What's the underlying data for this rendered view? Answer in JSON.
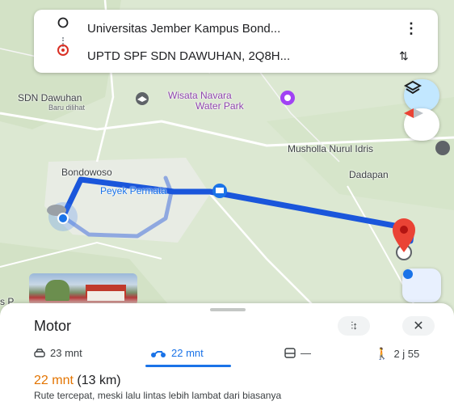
{
  "search": {
    "origin": "Universitas Jember Kampus Bond...",
    "destination": "UPTD SPF SDN DAWUHAN, 2Q8H...",
    "more_icon": "more-vert-icon",
    "swap_icon": "swap-icon"
  },
  "map": {
    "labels": {
      "sdn_dawuhan": "SDN Dawuhan",
      "baru_dilihat": "Baru dilihat",
      "wisata_line1": "Wisata Navara",
      "wisata_line2": "Water Park",
      "musholla": "Musholla Nurul Idris",
      "bondowoso": "Bondowoso",
      "dadapan": "Dadapan",
      "peyek": "Peyek Permata",
      "s_p": "s P"
    },
    "colors": {
      "route": "#1a56db",
      "destination_pin": "#ea4335",
      "accent": "#1a73e8"
    }
  },
  "sheet": {
    "title": "Motor",
    "filter_icon": "filter-icon",
    "close_icon": "close-icon",
    "modes": [
      {
        "icon": "car-icon",
        "label": "23 mnt"
      },
      {
        "icon": "motorcycle-icon",
        "label": "22 mnt"
      },
      {
        "icon": "transit-icon",
        "label": "—"
      },
      {
        "icon": "walk-icon",
        "label": "2 j 55"
      }
    ],
    "summary_time": "22 mnt",
    "summary_distance": "(13 km)",
    "description": "Rute tercepat, meski lalu lintas lebih lambat dari biasanya"
  }
}
